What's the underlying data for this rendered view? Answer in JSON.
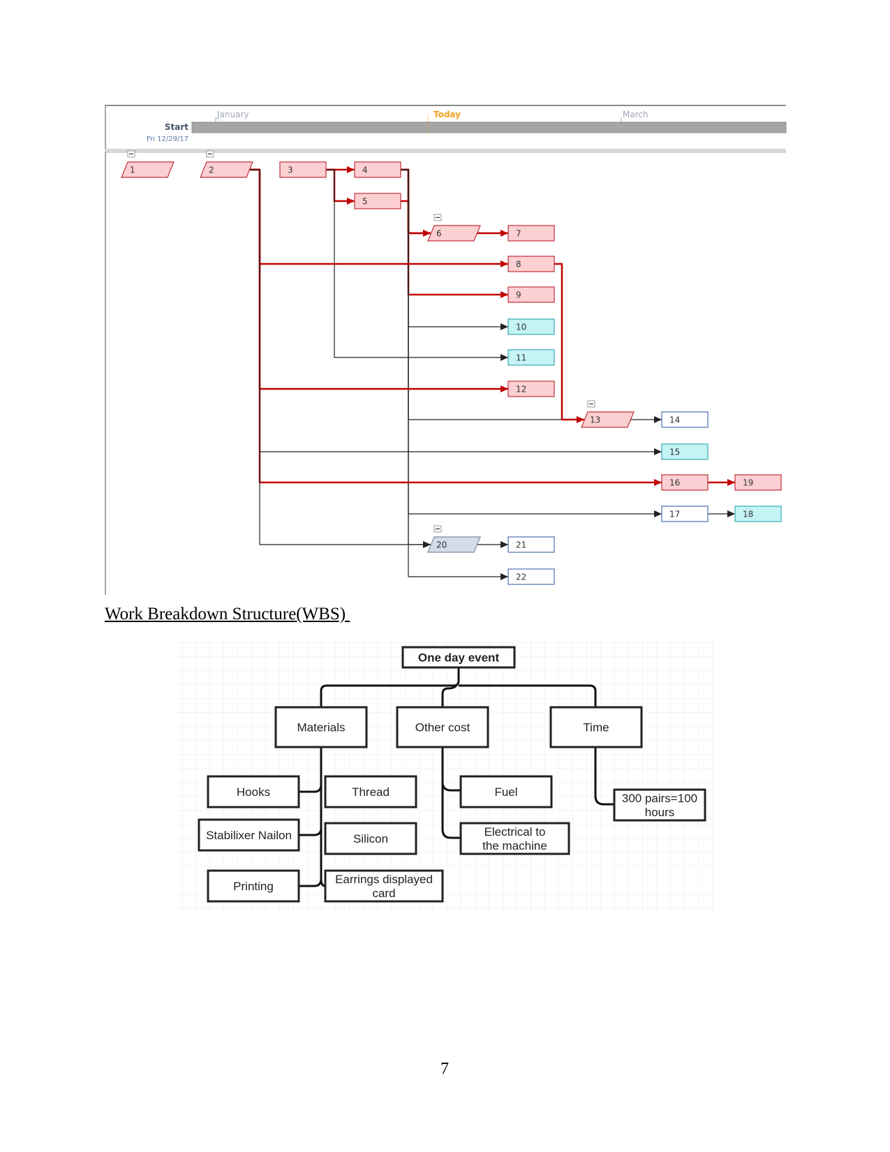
{
  "network_diagram": {
    "timeline": {
      "start_label": "Start",
      "start_date": "Fri 12/29/17",
      "months": [
        "January",
        "March"
      ],
      "today_label": "Today",
      "colors": {
        "today": "#f0a020",
        "month": "#a0a8b8",
        "bar": "#a6a6a6"
      }
    },
    "node_styles": {
      "critical": {
        "fill": "#fccfd2",
        "stroke": "#c0303a"
      },
      "cyan": {
        "fill": "#c4f4f6",
        "stroke": "#3aaab0"
      },
      "blue": {
        "fill": "#ffffff",
        "stroke": "#4a72b0"
      },
      "summary_blue": {
        "fill": "#d3dce8",
        "stroke": "#7d8da8"
      }
    },
    "nodes": [
      {
        "id": "1",
        "style": "critical",
        "summary": true
      },
      {
        "id": "2",
        "style": "critical",
        "summary": true
      },
      {
        "id": "3",
        "style": "critical",
        "summary": false
      },
      {
        "id": "4",
        "style": "critical",
        "summary": false
      },
      {
        "id": "5",
        "style": "critical",
        "summary": false
      },
      {
        "id": "6",
        "style": "critical",
        "summary": true
      },
      {
        "id": "7",
        "style": "critical",
        "summary": false
      },
      {
        "id": "8",
        "style": "critical",
        "summary": false
      },
      {
        "id": "9",
        "style": "critical",
        "summary": false
      },
      {
        "id": "10",
        "style": "cyan",
        "summary": false
      },
      {
        "id": "11",
        "style": "cyan",
        "summary": false
      },
      {
        "id": "12",
        "style": "critical",
        "summary": false
      },
      {
        "id": "13",
        "style": "critical",
        "summary": true
      },
      {
        "id": "14",
        "style": "blue",
        "summary": false
      },
      {
        "id": "15",
        "style": "cyan",
        "summary": false
      },
      {
        "id": "16",
        "style": "critical",
        "summary": false
      },
      {
        "id": "17",
        "style": "blue",
        "summary": false
      },
      {
        "id": "18",
        "style": "cyan",
        "summary": false
      },
      {
        "id": "19",
        "style": "critical",
        "summary": false
      },
      {
        "id": "20",
        "style": "summary_blue",
        "summary": true
      },
      {
        "id": "21",
        "style": "blue",
        "summary": false
      },
      {
        "id": "22",
        "style": "blue",
        "summary": false
      }
    ],
    "links": [
      {
        "from": "3",
        "to": "4",
        "critical": true
      },
      {
        "from": "3",
        "to": "5",
        "critical": true
      },
      {
        "from": "3",
        "to": "11",
        "critical": false
      },
      {
        "from": "4",
        "to": "6",
        "critical": true
      },
      {
        "from": "5",
        "to": "6",
        "critical": true
      },
      {
        "from": "4",
        "to": "9",
        "critical": true
      },
      {
        "from": "4",
        "to": "10",
        "critical": false
      },
      {
        "from": "4",
        "to": "13",
        "critical": false
      },
      {
        "from": "4",
        "to": "17",
        "critical": false
      },
      {
        "from": "4",
        "to": "20",
        "critical": false
      },
      {
        "from": "4",
        "to": "22",
        "critical": false
      },
      {
        "from": "6",
        "to": "7",
        "critical": true
      },
      {
        "from": "2",
        "to": "8",
        "critical": true
      },
      {
        "from": "2",
        "to": "12",
        "critical": true
      },
      {
        "from": "2",
        "to": "15",
        "critical": false
      },
      {
        "from": "2",
        "to": "16",
        "critical": true
      },
      {
        "from": "2",
        "to": "20",
        "critical": false
      },
      {
        "from": "8",
        "to": "13",
        "critical": true
      },
      {
        "from": "13",
        "to": "14",
        "critical": false
      },
      {
        "from": "16",
        "to": "19",
        "critical": true
      },
      {
        "from": "17",
        "to": "18",
        "critical": false
      },
      {
        "from": "20",
        "to": "21",
        "critical": false
      }
    ]
  },
  "section_heading": "Work Breakdown Structure(WBS) ",
  "wbs": {
    "root": "One day event",
    "branches": [
      {
        "label": "Materials",
        "children": [
          "Hooks",
          "Stabilixer Nailon",
          "Printing",
          "Thread",
          "Silicon",
          "Earrings displayed card"
        ]
      },
      {
        "label": "Other cost",
        "children": [
          "Fuel",
          "Electrical to the machine"
        ]
      },
      {
        "label": "Time",
        "children": [
          "300 pairs=100 hours"
        ]
      }
    ]
  },
  "page_number": "7"
}
